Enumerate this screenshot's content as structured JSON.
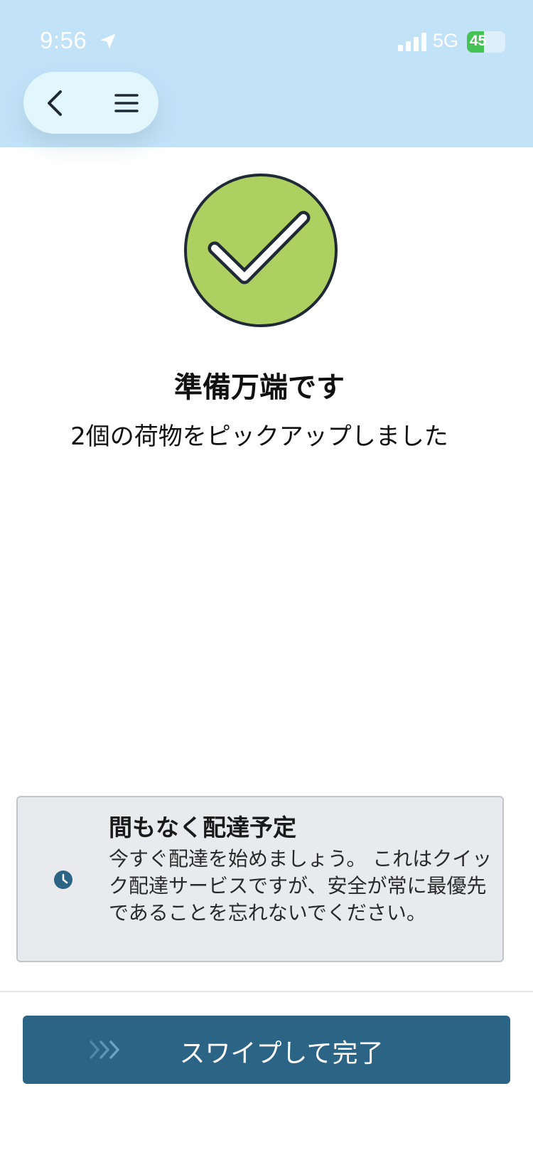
{
  "status_bar": {
    "time": "9:56",
    "network": "5G",
    "battery_level": "45"
  },
  "icons": {
    "location": "location-arrow-icon",
    "signal": "cellular-signal-icon",
    "back": "chevron-left-icon",
    "menu": "hamburger-menu-icon",
    "success": "checkmark-circle-icon",
    "clock": "clock-icon",
    "swipe": "triple-chevron-right-icon"
  },
  "colors": {
    "header_bg": "#c2e2f8",
    "success_green": "#aed061",
    "primary_button": "#2c6485",
    "notice_bg": "#e8eaed"
  },
  "main": {
    "title": "準備万端です",
    "subtitle": "2個の荷物をピックアップしました"
  },
  "notice": {
    "title": "間もなく配達予定",
    "body": "今すぐ配達を始めましょう。 これはクイック配達サービスですが、安全が常に最優先であることを忘れないでください。"
  },
  "action": {
    "swipe_label": "スワイプして完了"
  }
}
